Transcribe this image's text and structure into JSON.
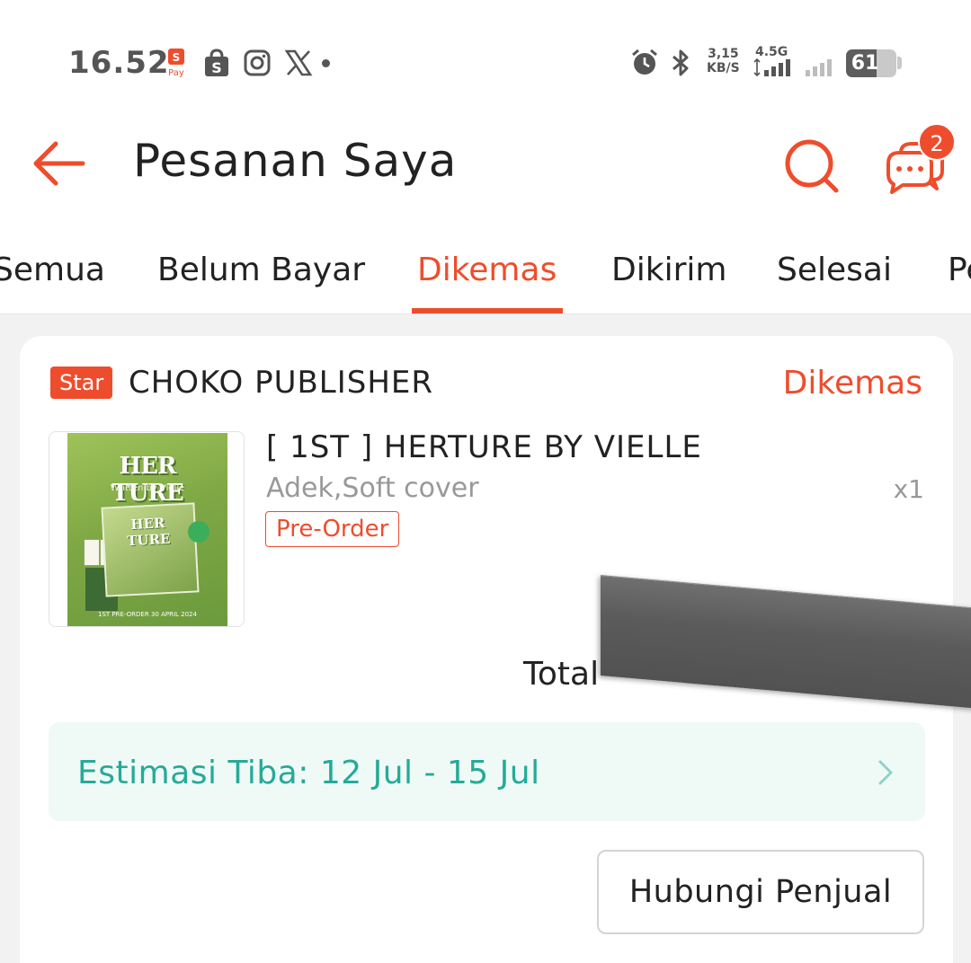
{
  "status_bar": {
    "time": "16.52",
    "net_speed_value": "3,15",
    "net_speed_unit": "KB/S",
    "network_type": "4.5G",
    "battery": "61",
    "battery_level": 0.61,
    "icons": [
      "shopeepay-icon",
      "shopee-icon",
      "instagram-icon",
      "x-icon",
      "alarm-icon",
      "bluetooth-icon",
      "signal-icon",
      "signal-weak-icon",
      "battery-icon"
    ]
  },
  "header": {
    "title": "Pesanan Saya",
    "chat_badge": "2"
  },
  "tabs": [
    {
      "label": "Semua",
      "active": false
    },
    {
      "label": "Belum Bayar",
      "active": false
    },
    {
      "label": "Dikemas",
      "active": true
    },
    {
      "label": "Dikirim",
      "active": false
    },
    {
      "label": "Selesai",
      "active": false
    },
    {
      "label": "Pe",
      "active": false
    }
  ],
  "order": {
    "shop_badge": "Star",
    "shop_name": "CHOKO PUBLISHER",
    "status": "Dikemas",
    "product": {
      "name": "[ 1ST ] HERTURE BY VIELLE",
      "variant": "Adek,Soft cover",
      "quantity": "x1",
      "tag": "Pre-Order",
      "cover_title": "HER TURE",
      "cover_subtitle": "Written by Vielle",
      "cover_inner_title": "HER TURE",
      "cover_footer": "1ST PRE-ORDER 30 APRIL 2024"
    },
    "total_label": "Total",
    "estimate": "Estimasi Tiba: 12 Jul - 15 Jul",
    "contact_button": "Hubungi Penjual"
  },
  "colors": {
    "accent": "#ee4d2d",
    "estimate_text": "#26aa99",
    "estimate_bg": "#effaf6"
  }
}
